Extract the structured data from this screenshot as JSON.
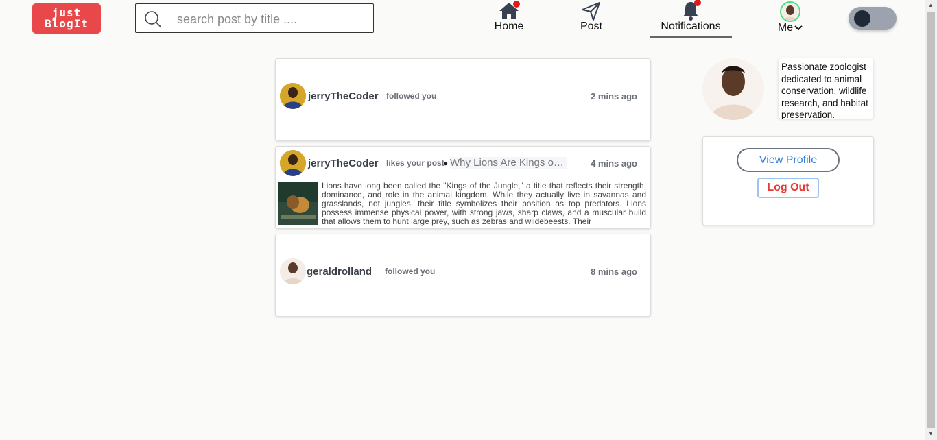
{
  "header": {
    "logo_line1": "just",
    "logo_line2": "BlogIt",
    "search_placeholder": "search post by title ....",
    "nav": {
      "home": "Home",
      "post": "Post",
      "notifications": "Notifications",
      "me": "Me"
    }
  },
  "notifications": [
    {
      "username": "jerryTheCoder",
      "action": "followed you",
      "time": "2 mins ago"
    },
    {
      "username": "jerryTheCoder",
      "action": "likes your post",
      "post_title": "Why Lions Are Kings of the Jungle",
      "excerpt": "Lions have long been called the \"Kings of the Jungle,\" a title that reflects their strength, dominance, and role in the animal kingdom. While they actually live in savannas and grasslands, not jungles, their title symbolizes their position as top predators. Lions possess immense physical power, with strong jaws, sharp claws, and a muscular build that allows them to hunt large prey, such as zebras and wildebeests. Their",
      "time": "4 mins ago"
    },
    {
      "username": "geraldrolland",
      "action": "followed you",
      "time": "8 mins ago"
    }
  ],
  "sidebar": {
    "bio": "Passionate zoologist dedicated to animal conservation, wildlife research, and habitat preservation.",
    "view_profile": "View Profile",
    "log_out": "Log Out"
  },
  "icons": {
    "search": "search-icon",
    "home": "home-icon",
    "post": "send-icon",
    "notifications": "bell-icon",
    "chevron": "chevron-down-icon"
  },
  "colors": {
    "brand": "#e8484a",
    "badge": "#e0191b",
    "link": "#2f7bdf",
    "logout": "#e53935"
  }
}
